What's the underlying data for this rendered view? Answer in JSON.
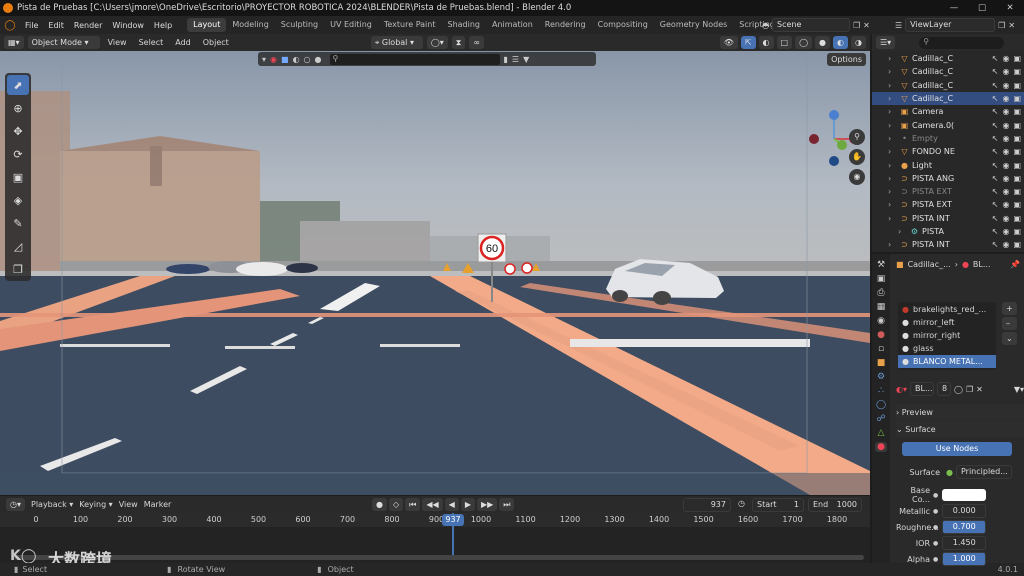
{
  "window": {
    "title": "Pista de Pruebas [C:\\Users\\jmore\\OneDrive\\Escritorio\\PROYECTOR ROBOTICA 2024\\BLENDER\\Pista de Pruebas.blend] - Blender 4.0"
  },
  "menu": [
    "File",
    "Edit",
    "Render",
    "Window",
    "Help"
  ],
  "workspaces": [
    "Layout",
    "Modeling",
    "Sculpting",
    "UV Editing",
    "Texture Paint",
    "Shading",
    "Animation",
    "Rendering",
    "Compositing",
    "Geometry Nodes",
    "Scripting"
  ],
  "scene": {
    "label": "Scene"
  },
  "viewlayer": {
    "label": "ViewLayer"
  },
  "viewport_header": {
    "mode": "Object Mode",
    "menus": [
      "View",
      "Select",
      "Add",
      "Object"
    ],
    "transform": "Global",
    "options": "Options"
  },
  "road_sign": {
    "speed": "60"
  },
  "outliner": {
    "items": [
      {
        "name": "Cadillac_C",
        "icon": "mesh-icon",
        "color": "#e8a04a",
        "selected": false,
        "dim": false
      },
      {
        "name": "Cadillac_C",
        "icon": "mesh-icon",
        "color": "#e8a04a",
        "selected": false,
        "dim": false
      },
      {
        "name": "Cadillac_C",
        "icon": "mesh-icon",
        "color": "#e8a04a",
        "selected": false,
        "dim": false
      },
      {
        "name": "Cadillac_C",
        "icon": "mesh-icon",
        "color": "#e8a04a",
        "selected": true,
        "dim": false
      },
      {
        "name": "Camera",
        "icon": "camera-icon",
        "color": "#e8a04a",
        "selected": false,
        "dim": false
      },
      {
        "name": "Camera.0(",
        "icon": "camera-icon",
        "color": "#e8a04a",
        "selected": false,
        "dim": false
      },
      {
        "name": "Empty",
        "icon": "empty-icon",
        "color": "#888888",
        "selected": false,
        "dim": true
      },
      {
        "name": "FONDO NE",
        "icon": "mesh-icon",
        "color": "#e8a04a",
        "selected": false,
        "dim": false
      },
      {
        "name": "Light",
        "icon": "light-icon",
        "color": "#e8a04a",
        "selected": false,
        "dim": false
      },
      {
        "name": "PISTA ANG",
        "icon": "curve-icon",
        "color": "#e8a04a",
        "selected": false,
        "dim": false
      },
      {
        "name": "PISTA EXT",
        "icon": "curve-icon",
        "color": "#888888",
        "selected": false,
        "dim": true
      },
      {
        "name": "PISTA EXT",
        "icon": "curve-icon",
        "color": "#e8a04a",
        "selected": false,
        "dim": false
      },
      {
        "name": "PISTA INT",
        "icon": "curve-icon",
        "color": "#e8a04a",
        "selected": false,
        "dim": false
      },
      {
        "name": "PISTA",
        "icon": "modifier-icon",
        "color": "#6cc",
        "selected": false,
        "dim": false
      },
      {
        "name": "PISTA INT",
        "icon": "curve-icon",
        "color": "#e8a04a",
        "selected": false,
        "dim": false
      }
    ]
  },
  "properties": {
    "breadcrumb": {
      "object": "Cadillac_...",
      "material": "BL..."
    },
    "slots": [
      "brakelights_red_...",
      "mirror_left",
      "mirror_right",
      "glass",
      "BLANCO METAL..."
    ],
    "material_name": "BL...",
    "user_count": "8",
    "panels": {
      "preview": "Preview",
      "surface": "Surface"
    },
    "use_nodes": "Use Nodes",
    "surface_label": "Surface",
    "surface_value": "Principled...",
    "fields": [
      {
        "label": "Base Co...",
        "value": "",
        "type": "color"
      },
      {
        "label": "Metallic",
        "value": "0.000",
        "type": "num"
      },
      {
        "label": "Roughne...",
        "value": "0.700",
        "type": "slider"
      },
      {
        "label": "IOR",
        "value": "1.450",
        "type": "num"
      },
      {
        "label": "Alpha",
        "value": "1.000",
        "type": "slider"
      }
    ]
  },
  "timeline": {
    "menus": [
      "Playback",
      "Keying",
      "View",
      "Marker"
    ],
    "current_frame": "937",
    "start_label": "Start",
    "start": "1",
    "end_label": "End",
    "end": "1000",
    "ticks": [
      "0",
      "100",
      "200",
      "300",
      "400",
      "500",
      "600",
      "700",
      "800",
      "900",
      "1000",
      "1100",
      "1200",
      "1300",
      "1400",
      "1500",
      "1600",
      "1700",
      "1800"
    ],
    "playhead": "937"
  },
  "status": {
    "select": "Select",
    "rotate": "Rotate View",
    "object": "Object",
    "version": "4.0.1"
  },
  "watermark": "大数跨境"
}
